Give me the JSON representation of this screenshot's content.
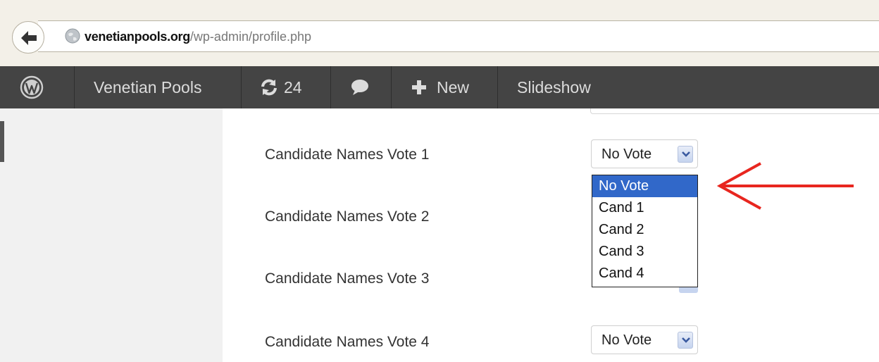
{
  "browser": {
    "url_domain": "venetianpools.org",
    "url_path": "/wp-admin/profile.php",
    "back_icon": "back-arrow-icon",
    "site_icon": "globe-icon"
  },
  "admin_bar": {
    "logo_icon": "wordpress-logo-icon",
    "site_name": "Venetian Pools",
    "updates_count": "24",
    "new_label": "New",
    "slideshow_label": "Slideshow"
  },
  "form": {
    "votes": [
      {
        "label": "Candidate Names Vote 1",
        "value": "No Vote"
      },
      {
        "label": "Candidate Names Vote 2",
        "value": ""
      },
      {
        "label": "Candidate Names Vote 3",
        "value": ""
      },
      {
        "label": "Candidate Names Vote 4",
        "value": "No Vote"
      }
    ],
    "dropdown_options": [
      "No Vote",
      "Cand 1",
      "Cand 2",
      "Cand 3",
      "Cand 4"
    ],
    "selected_option": "No Vote"
  },
  "colors": {
    "admin_bar": "#444444",
    "selected_option": "#3168c9",
    "annotation_arrow": "#e8261f"
  }
}
